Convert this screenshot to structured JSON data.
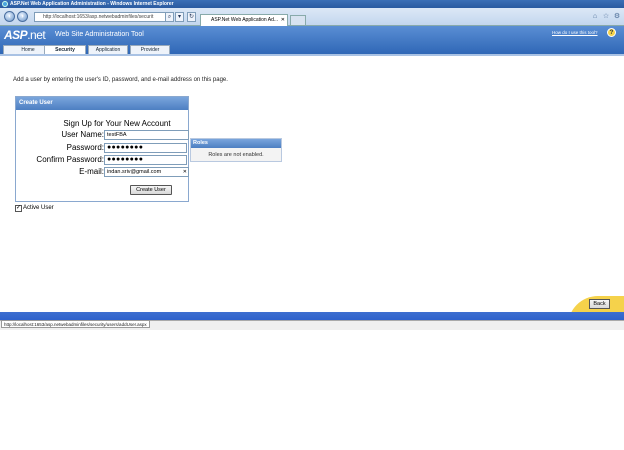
{
  "window": {
    "title": "ASP.Net Web Application Administration - Windows Internet Explorer"
  },
  "browser": {
    "address": "http://localhost:1653/asp.netwebadminfiles/securit",
    "tab_title": "ASP.Net Web Application Ad...",
    "tab_close": "✕"
  },
  "app": {
    "logo_asp": "ASP",
    "logo_net": ".net",
    "title": "Web Site Administration Tool",
    "help_link": "How do I use this tool?",
    "help_icon": "?",
    "tabs": [
      {
        "label": "Home"
      },
      {
        "label": "Security",
        "active": true
      },
      {
        "label": "Application"
      },
      {
        "label": "Provider"
      }
    ]
  },
  "page": {
    "intro": "Add a user by entering the user's ID, password, and e-mail address on this page."
  },
  "create_user": {
    "header": "Create User",
    "title": "Sign Up for Your New Account",
    "fields": {
      "username_label": "User Name:",
      "username_value": "testFBA",
      "password_label": "Password:",
      "password_value": "●●●●●●●●",
      "confirm_label": "Confirm Password:",
      "confirm_value": "●●●●●●●●",
      "email_label": "E-mail:",
      "email_value": "indan.sriv@gmail.com"
    },
    "button": "Create User"
  },
  "roles": {
    "header": "Roles",
    "message": "Roles are not enabled."
  },
  "active_user": {
    "label": "Active User",
    "checked": true,
    "check_mark": "✓"
  },
  "footer": {
    "back_button": "Back"
  },
  "status": {
    "url": "http://localhost:1653/asp.netwebadminfiles/security/users/addUser.aspx"
  },
  "icons": {
    "nav_back": "back-arrow-icon",
    "nav_forward": "forward-arrow-icon",
    "refresh": "refresh-icon",
    "search": "search-icon",
    "home": "home-icon",
    "favorites": "star-icon",
    "tools": "gear-icon"
  },
  "colors": {
    "header_blue": "#2f67b6",
    "footer_yellow": "#f5d24b",
    "panel_header": "#4d7fc2"
  }
}
